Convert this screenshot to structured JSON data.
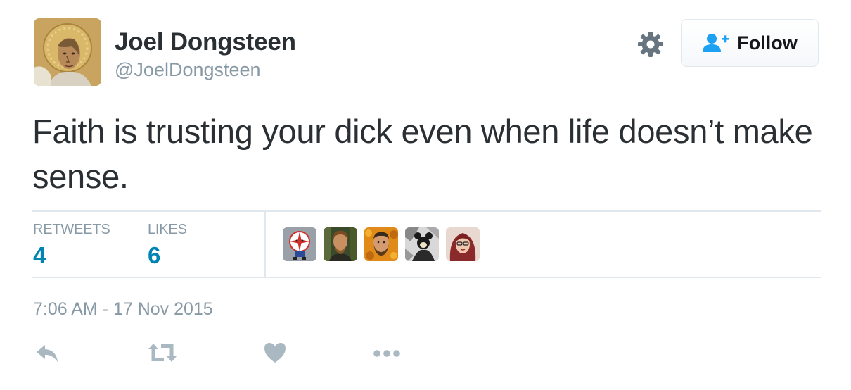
{
  "author": {
    "name": "Joel Dongsteen",
    "handle": "@JoelDongsteen"
  },
  "follow_button": {
    "label": "Follow",
    "icon": "add-user-icon"
  },
  "settings": {
    "icon": "gear-icon"
  },
  "tweet": {
    "text": "Faith is trusting your dick even when life doesn’t make sense.",
    "timestamp": "7:06 AM - 17 Nov 2015"
  },
  "stats": {
    "retweets_label": "RETWEETS",
    "retweets_value": "4",
    "likes_label": "LIKES",
    "likes_value": "6"
  },
  "likers": [
    {
      "name": "liker-avatar-1"
    },
    {
      "name": "liker-avatar-2"
    },
    {
      "name": "liker-avatar-3"
    },
    {
      "name": "liker-avatar-4"
    },
    {
      "name": "liker-avatar-5"
    }
  ],
  "actions": [
    {
      "icon": "reply-icon"
    },
    {
      "icon": "retweet-icon"
    },
    {
      "icon": "heart-icon"
    },
    {
      "icon": "more-icon"
    }
  ],
  "colors": {
    "text": "#292f33",
    "muted": "#8899a6",
    "link": "#0084b4",
    "follow_icon": "#1da1f2",
    "divider": "#e1e8ed"
  }
}
